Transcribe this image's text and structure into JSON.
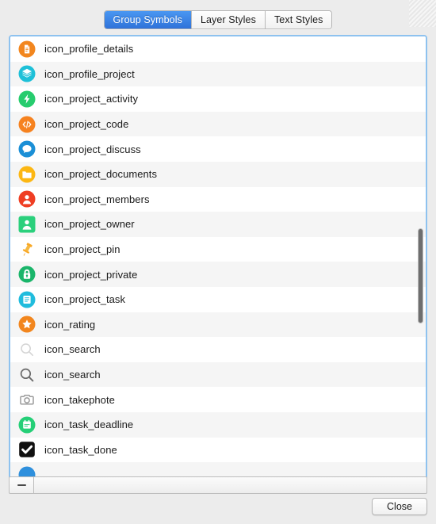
{
  "window": {
    "grip": "resize-grip"
  },
  "tabs": [
    {
      "label": "Group Symbols",
      "active": true
    },
    {
      "label": "Layer Styles",
      "active": false
    },
    {
      "label": "Text Styles",
      "active": false
    }
  ],
  "list": {
    "items": [
      {
        "label": "icon_profile_details",
        "icon": "document-circle-icon",
        "color": "#f2861e"
      },
      {
        "label": "icon_profile_project",
        "icon": "layers-circle-icon",
        "color": "#1ec0d8"
      },
      {
        "label": "icon_project_activity",
        "icon": "bolt-circle-icon",
        "color": "#27cc6e"
      },
      {
        "label": "icon_project_code",
        "icon": "code-circle-icon",
        "color": "#f6821f"
      },
      {
        "label": "icon_project_discuss",
        "icon": "chat-circle-icon",
        "color": "#1b8fd6"
      },
      {
        "label": "icon_project_documents",
        "icon": "folder-circle-icon",
        "color": "#fcb713"
      },
      {
        "label": "icon_project_members",
        "icon": "members-circle-icon",
        "color": "#ef3e23"
      },
      {
        "label": "icon_project_owner",
        "icon": "person-square-icon",
        "color": "#2bd07c"
      },
      {
        "label": "icon_project_pin",
        "icon": "pushpin-icon",
        "color": "#f5a623"
      },
      {
        "label": "icon_project_private",
        "icon": "lock-circle-icon",
        "color": "#1ab56a"
      },
      {
        "label": "icon_project_task",
        "icon": "task-circle-icon",
        "color": "#20bcdd"
      },
      {
        "label": "icon_rating",
        "icon": "star-circle-icon",
        "color": "#f2861e"
      },
      {
        "label": "icon_search",
        "icon": "search-light-icon",
        "color": "#d4d4d4"
      },
      {
        "label": "icon_search",
        "icon": "search-dark-icon",
        "color": "#6b6b6b"
      },
      {
        "label": "icon_takephote",
        "icon": "camera-outline-icon",
        "color": "#9b9b9b"
      },
      {
        "label": "icon_task_deadline",
        "icon": "calendar-circle-icon",
        "color": "#25cf77"
      },
      {
        "label": "icon_task_done",
        "icon": "checkbox-checked-icon",
        "color": "#101010"
      },
      {
        "label": "",
        "icon": "partial-blue-circle-icon",
        "color": "#2f90dd"
      }
    ]
  },
  "scrollbar": {
    "name": "vertical-scrollbar"
  },
  "bottom_bar": {
    "remove_label": "−"
  },
  "footer": {
    "close_label": "Close"
  }
}
